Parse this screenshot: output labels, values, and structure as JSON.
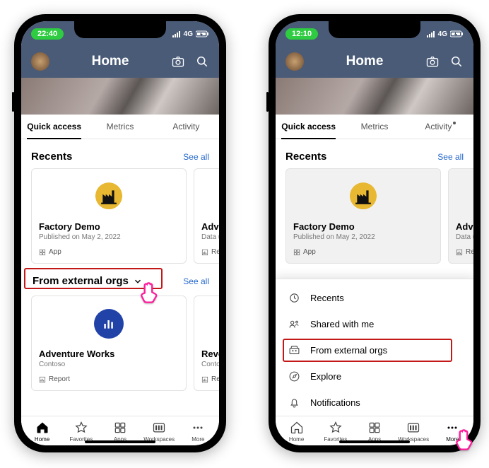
{
  "left": {
    "status_time": "22:40",
    "status_network": "4G",
    "header_title": "Home",
    "tabs": [
      "Quick access",
      "Metrics",
      "Activity"
    ],
    "active_tab": 0,
    "recents": {
      "title": "Recents",
      "see_all": "See all",
      "cards": [
        {
          "title": "Factory Demo",
          "sub": "Published on May 2, 2022",
          "type": "App"
        },
        {
          "title": "Adve",
          "sub": "Data u",
          "type": "Rep"
        }
      ]
    },
    "external": {
      "title": "From external orgs",
      "see_all": "See all",
      "cards": [
        {
          "title": "Adventure Works",
          "sub": "Contoso",
          "type": "Report"
        },
        {
          "title": "Reve",
          "sub": "Conto",
          "type": "Rep"
        }
      ]
    },
    "nav": [
      "Home",
      "Favorites",
      "Apps",
      "Workspaces",
      "More"
    ]
  },
  "right": {
    "status_time": "12:10",
    "status_network": "4G",
    "header_title": "Home",
    "tabs": [
      "Quick access",
      "Metrics",
      "Activity"
    ],
    "active_tab": 0,
    "activity_dot": true,
    "recents": {
      "title": "Recents",
      "see_all": "See all",
      "cards": [
        {
          "title": "Factory Demo",
          "sub": "Published on May 2, 2022",
          "type": "App"
        },
        {
          "title": "Adve",
          "sub": "Data u",
          "type": "Rep"
        }
      ]
    },
    "sheet_items": [
      "Recents",
      "Shared with me",
      "From external orgs",
      "Explore",
      "Notifications"
    ],
    "nav": [
      "Home",
      "Favorites",
      "Apps",
      "Workspaces",
      "More"
    ]
  }
}
